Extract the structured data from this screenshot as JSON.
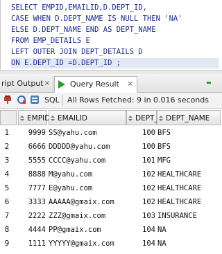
{
  "editor": {
    "lines": [
      "SELECT EMPID,EMAILID,D.DEPT_ID,",
      "CASE WHEN D.DEPT_NAME IS NULL THEN 'NA'",
      "ELSE D.DEPT_NAME END AS DEPT_NAME",
      "FROM EMP_DETAILS E",
      "LEFT OUTER JOIN DEPT_DETAILS D",
      "ON E.DEPT_ID =D.DEPT_ID ;"
    ]
  },
  "tabs": {
    "script_output": "ript Output",
    "query_result": "Query Result",
    "close_glyph": "×"
  },
  "toolbar": {
    "sql_label": "SQL",
    "status": "All Rows Fetched: 9 in 0.016 seconds"
  },
  "grid": {
    "columns": [
      "EMPID",
      "EMAILID",
      "DEPT_ID",
      "DEPT_NAME"
    ],
    "rows": [
      {
        "n": "1",
        "empid": "9999",
        "email": "SS@yahu.com",
        "dept_id": "100",
        "dept_name": "BFS"
      },
      {
        "n": "2",
        "empid": "6666",
        "email": "DDDDD@yahu.com",
        "dept_id": "100",
        "dept_name": "BFS"
      },
      {
        "n": "3",
        "empid": "5555",
        "email": "CCCC@yahu.com",
        "dept_id": "101",
        "dept_name": "MFG"
      },
      {
        "n": "4",
        "empid": "8888",
        "email": "M@yahu.com",
        "dept_id": "102",
        "dept_name": "HEALTHCARE"
      },
      {
        "n": "5",
        "empid": "7777",
        "email": "E@yahu.com",
        "dept_id": "102",
        "dept_name": "HEALTHCARE"
      },
      {
        "n": "6",
        "empid": "3333",
        "email": "AAAAA@gmaix.com",
        "dept_id": "102",
        "dept_name": "HEALTHCARE"
      },
      {
        "n": "7",
        "empid": "2222",
        "email": "ZZZ@gmaix.com",
        "dept_id": "103",
        "dept_name": "INSURANCE"
      },
      {
        "n": "8",
        "empid": "4444",
        "email": "PP@gmaix.com",
        "dept_id": "104",
        "dept_name": "NA"
      },
      {
        "n": "9",
        "empid": "1111",
        "email": "YYYYY@gmaix.com",
        "dept_id": "104",
        "dept_name": "NA"
      }
    ]
  },
  "colors": {
    "keyword": "#1b2a8a",
    "run_green": "#2e9a2e",
    "line_highlight": "#e3e8f5"
  },
  "icons": [
    "pin-icon",
    "refresh-icon",
    "sql-export-icon",
    "run-statement-icon",
    "sort-icon"
  ]
}
